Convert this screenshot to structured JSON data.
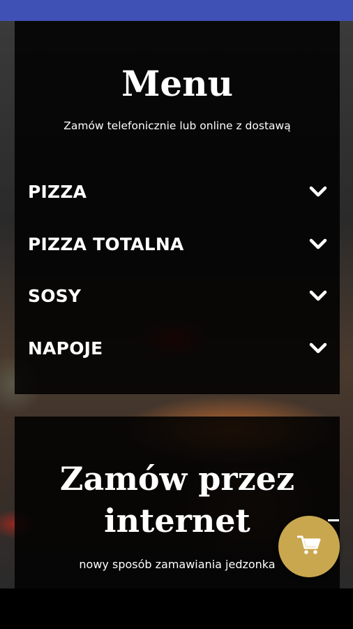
{
  "menu": {
    "title": "Menu",
    "subtitle": "Zamów telefonicznie lub online z dostawą",
    "sections": [
      {
        "label": "PIZZA",
        "icon": "chevron-down-icon"
      },
      {
        "label": "PIZZA TOTALNA",
        "icon": "chevron-down-icon"
      },
      {
        "label": "SOSY",
        "icon": "chevron-down-icon"
      },
      {
        "label": "NAPOJE",
        "icon": "chevron-down-icon"
      }
    ]
  },
  "order": {
    "title_line1": "Zamów przez",
    "title_line2": "internet",
    "subtitle": "nowy sposób zamawiania jedzonka"
  },
  "cart": {
    "icon": "cart-icon"
  },
  "colors": {
    "status_bar": "#3f51b5",
    "cart_button": "#c9a74e",
    "card_background": "#000000",
    "text": "#ffffff"
  }
}
